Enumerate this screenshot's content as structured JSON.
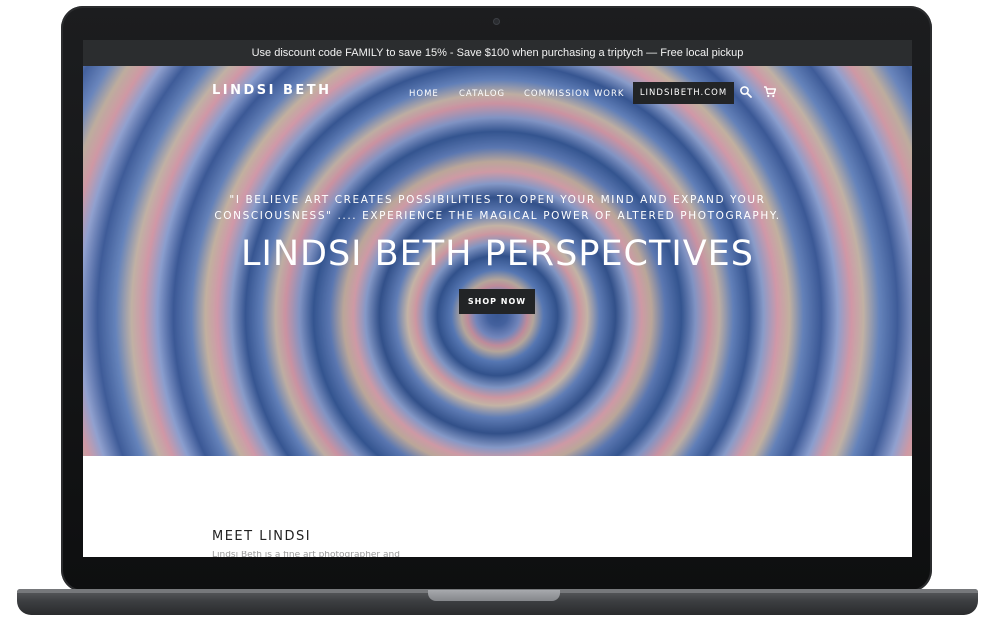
{
  "announcement": "Use discount code FAMILY to save 15% - Save $100 when purchasing a triptych — Free local pickup",
  "header": {
    "logo": "LINDSI BETH",
    "nav": {
      "home": "HOME",
      "catalog": "CATALOG",
      "commission": "COMMISSION WORK",
      "site": "LINDSIBETH.COM"
    },
    "icons": [
      "search-icon",
      "cart-icon"
    ]
  },
  "hero": {
    "quote_line1": "\"I BELIEVE ART CREATES POSSIBILITIES TO OPEN YOUR MIND AND EXPAND YOUR",
    "quote_line2": "CONSCIOUSNESS\" .... EXPERIENCE THE MAGICAL POWER OF ALTERED PHOTOGRAPHY.",
    "headline": "LINDSI BETH PERSPECTIVES",
    "cta": "SHOP NOW"
  },
  "about": {
    "heading": "MEET LINDSI",
    "snippet": "Lindsi Beth is a fine art photographer and"
  },
  "colors": {
    "announcement_bg": "#2b2d2f",
    "button_bg": "#222426",
    "text_light": "#ffffff"
  }
}
